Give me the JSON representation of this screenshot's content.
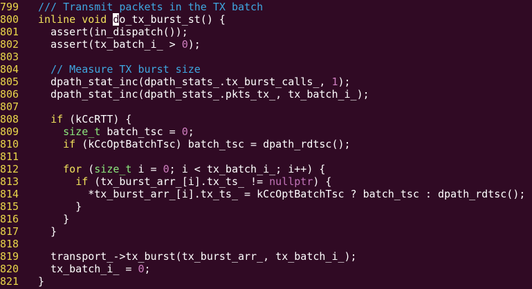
{
  "editor": {
    "theme": {
      "background": "#300a24",
      "line_number_color": "#e9d54a",
      "text_color": "#ffffff",
      "comment_color": "#3fa7e0",
      "keyword_color": "#f0e05c",
      "type_color": "#8be87d",
      "number_color": "#d07ec0"
    },
    "cursor": {
      "line": "800",
      "column": 13
    },
    "lines": [
      {
        "num": "799",
        "tokens": [
          {
            "t": "comment",
            "v": "/// Transmit packets in the TX batch"
          }
        ]
      },
      {
        "num": "800",
        "tokens": [
          {
            "t": "keyword",
            "v": "inline"
          },
          {
            "t": "plain",
            "v": " "
          },
          {
            "t": "keyword",
            "v": "void"
          },
          {
            "t": "plain",
            "v": " "
          },
          {
            "t": "cursor",
            "v": "d"
          },
          {
            "t": "plain",
            "v": "o_tx_burst_st() {"
          }
        ]
      },
      {
        "num": "801",
        "tokens": [
          {
            "t": "plain",
            "v": "  assert(in_dispatch());"
          }
        ]
      },
      {
        "num": "802",
        "tokens": [
          {
            "t": "plain",
            "v": "  assert(tx_batch_i_ > "
          },
          {
            "t": "number",
            "v": "0"
          },
          {
            "t": "plain",
            "v": ");"
          }
        ]
      },
      {
        "num": "803",
        "tokens": []
      },
      {
        "num": "804",
        "tokens": [
          {
            "t": "plain",
            "v": "  "
          },
          {
            "t": "comment",
            "v": "// Measure TX burst size"
          }
        ]
      },
      {
        "num": "805",
        "tokens": [
          {
            "t": "plain",
            "v": "  dpath_stat_inc(dpath_stats_.tx_burst_calls_, "
          },
          {
            "t": "number",
            "v": "1"
          },
          {
            "t": "plain",
            "v": ");"
          }
        ]
      },
      {
        "num": "806",
        "tokens": [
          {
            "t": "plain",
            "v": "  dpath_stat_inc(dpath_stats_.pkts_tx_, tx_batch_i_);"
          }
        ]
      },
      {
        "num": "807",
        "tokens": []
      },
      {
        "num": "808",
        "tokens": [
          {
            "t": "plain",
            "v": "  "
          },
          {
            "t": "keyword",
            "v": "if"
          },
          {
            "t": "plain",
            "v": " (kCcRTT) {"
          }
        ]
      },
      {
        "num": "809",
        "tokens": [
          {
            "t": "plain",
            "v": "    "
          },
          {
            "t": "type",
            "v": "size_t"
          },
          {
            "t": "plain",
            "v": " batch_tsc = "
          },
          {
            "t": "number",
            "v": "0"
          },
          {
            "t": "plain",
            "v": ";"
          }
        ]
      },
      {
        "num": "810",
        "tokens": [
          {
            "t": "plain",
            "v": "    "
          },
          {
            "t": "keyword",
            "v": "if"
          },
          {
            "t": "plain",
            "v": " (kCcOptBatchTsc) batch_tsc = dpath_rdtsc();"
          }
        ]
      },
      {
        "num": "811",
        "tokens": []
      },
      {
        "num": "812",
        "tokens": [
          {
            "t": "plain",
            "v": "    "
          },
          {
            "t": "keyword",
            "v": "for"
          },
          {
            "t": "plain",
            "v": " ("
          },
          {
            "t": "type",
            "v": "size_t"
          },
          {
            "t": "plain",
            "v": " i = "
          },
          {
            "t": "number",
            "v": "0"
          },
          {
            "t": "plain",
            "v": "; i < tx_batch_i_; i++) {"
          }
        ]
      },
      {
        "num": "813",
        "tokens": [
          {
            "t": "plain",
            "v": "      "
          },
          {
            "t": "keyword",
            "v": "if"
          },
          {
            "t": "plain",
            "v": " (tx_burst_arr_[i].tx_ts_ != "
          },
          {
            "t": "const",
            "v": "nullptr"
          },
          {
            "t": "plain",
            "v": ") {"
          }
        ]
      },
      {
        "num": "814",
        "tokens": [
          {
            "t": "plain",
            "v": "        *tx_burst_arr_[i].tx_ts_ = kCcOptBatchTsc ? batch_tsc : dpath_rdtsc();"
          }
        ]
      },
      {
        "num": "815",
        "tokens": [
          {
            "t": "plain",
            "v": "      }"
          }
        ]
      },
      {
        "num": "816",
        "tokens": [
          {
            "t": "plain",
            "v": "    }"
          }
        ]
      },
      {
        "num": "817",
        "tokens": [
          {
            "t": "plain",
            "v": "  }"
          }
        ]
      },
      {
        "num": "818",
        "tokens": []
      },
      {
        "num": "819",
        "tokens": [
          {
            "t": "plain",
            "v": "  transport_->tx_burst(tx_burst_arr_, tx_batch_i_);"
          }
        ]
      },
      {
        "num": "820",
        "tokens": [
          {
            "t": "plain",
            "v": "  tx_batch_i_ = "
          },
          {
            "t": "number",
            "v": "0"
          },
          {
            "t": "plain",
            "v": ";"
          }
        ]
      },
      {
        "num": "821",
        "tokens": [
          {
            "t": "plain",
            "v": "}"
          }
        ]
      }
    ]
  }
}
